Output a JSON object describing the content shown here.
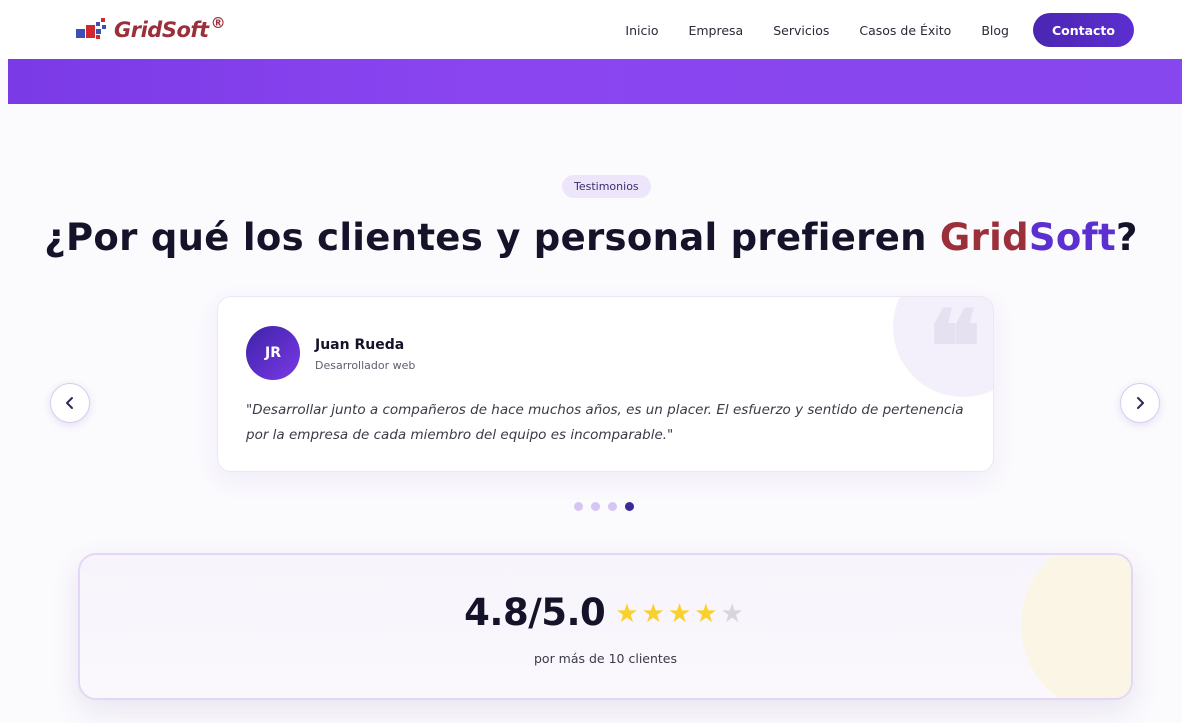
{
  "brand": {
    "name": "GridSoft",
    "registered": "®",
    "color_primary": "#9b2f3a",
    "color_secondary": "#5b2fd0"
  },
  "nav": {
    "items": [
      "Inicio",
      "Empresa",
      "Servicios",
      "Casos de Éxito",
      "Blog"
    ],
    "cta": "Contacto"
  },
  "section": {
    "badge": "Testimonios",
    "title_prefix": "¿Por qué los clientes y personal prefieren ",
    "title_brand_a": "Grid",
    "title_brand_b": "Soft",
    "title_suffix": "?"
  },
  "testimonial": {
    "initials": "JR",
    "name": "Juan Rueda",
    "role": "Desarrollador web",
    "quote": "\"Desarrollar junto a compañeros de hace muchos años, es un placer. El esfuerzo y sentido de pertenencia por la empresa de cada miembro del equipo es incomparable.\"",
    "quote_icon": "quote-icon"
  },
  "carousel": {
    "total_slides": 4,
    "active_slide": 4,
    "prev_icon": "chevron-left-icon",
    "next_icon": "chevron-right-icon"
  },
  "rating": {
    "value": "4.8/5.0",
    "stars_filled": 4,
    "stars_total": 5,
    "subtitle": "por más de 10 clientes",
    "star_color": "#fad02c"
  }
}
